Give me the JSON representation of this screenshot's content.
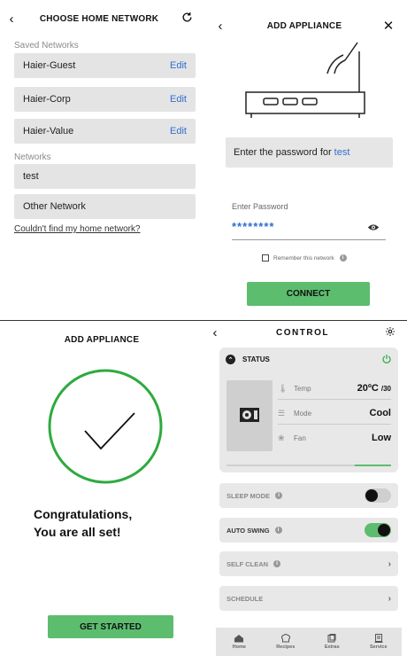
{
  "choose_network": {
    "title": "CHOOSE HOME NETWORK",
    "saved_label": "Saved Networks",
    "saved": [
      {
        "name": "Haier-Guest",
        "edit": "Edit"
      },
      {
        "name": "Haier-Corp",
        "edit": "Edit"
      },
      {
        "name": "Haier-Value",
        "edit": "Edit"
      }
    ],
    "networks_label": "Networks",
    "networks": [
      "test",
      "Other Network"
    ],
    "help_link": "Couldn't find my home network?"
  },
  "add_appliance_password": {
    "title": "ADD APPLIANCE",
    "prompt_prefix": "Enter the password for",
    "network_name": "test",
    "password_label": "Enter Password",
    "password_value": "********",
    "remember_label": "Remember this network",
    "info_glyph": "i",
    "connect_label": "CONNECT"
  },
  "add_appliance_success": {
    "title": "ADD APPLIANCE",
    "line1": "Congratulations,",
    "line2": "You are all set!",
    "button_label": "GET STARTED"
  },
  "control": {
    "title": "CONTROL",
    "status_label": "STATUS",
    "params": [
      {
        "label": "Temp",
        "value": "20ºC",
        "suffix": "/30",
        "icon": "thermometer-icon"
      },
      {
        "label": "Mode",
        "value": "Cool",
        "suffix": "",
        "icon": "mode-icon"
      },
      {
        "label": "Fan",
        "value": "Low",
        "suffix": "",
        "icon": "fan-icon"
      }
    ],
    "status_progress": {
      "start": 0.78,
      "end": 1.0
    },
    "rows": [
      {
        "label": "SLEEP MODE",
        "info": "i",
        "type": "toggle",
        "state": "off"
      },
      {
        "label": "AUTO SWING",
        "info": "i",
        "type": "toggle",
        "state": "on"
      },
      {
        "label": "SELF CLEAN",
        "info": "i",
        "type": "chevron"
      },
      {
        "label": "SCHEDULE",
        "info": "",
        "type": "chevron"
      }
    ],
    "nav": [
      "Home",
      "Recipes",
      "Extras",
      "Service"
    ]
  },
  "colors": {
    "accent_green": "#5cbd6f",
    "link_blue": "#2f6fd1",
    "card_gray": "#e4e4e4"
  }
}
